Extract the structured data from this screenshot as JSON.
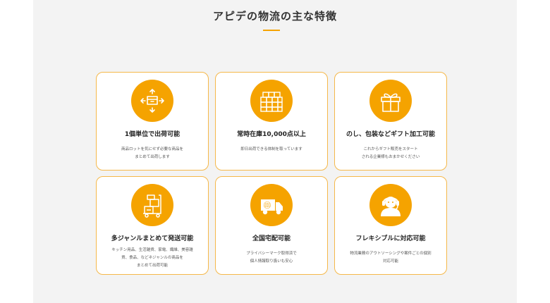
{
  "section": {
    "title": "アピデの物流の主な特徴"
  },
  "features": [
    {
      "title": "1個単位で出荷可能",
      "desc_line1": "商品ロットを気にせず必要な商品を",
      "desc_line2": "まとめて出荷します",
      "icon": "box-arrows-icon"
    },
    {
      "title": "常時在庫10,000点以上",
      "desc_line1": "即日出荷できる体制を取っています",
      "desc_line2": "",
      "icon": "stacked-boxes-icon"
    },
    {
      "title": "のし、包装などギフト加工可能",
      "desc_line1": "これからギフト販売をスタート",
      "desc_line2": "される企業様もおまかせください",
      "icon": "gift-icon"
    },
    {
      "title": "多ジャンルまとめて発送可能",
      "desc_line1": "キッチン用品、生活雑貨、家電、繊維、美容雑",
      "desc_line2": "貨、食品、などネジャンルの商品を",
      "desc_line3": "まとめて出荷可能",
      "icon": "hand-truck-icon"
    },
    {
      "title": "全国宅配可能",
      "desc_line1": "プライバシーマーク取得済で",
      "desc_line2": "個人情報取り扱いも安心",
      "icon": "delivery-truck-icon"
    },
    {
      "title": "フレキシブルに対応可能",
      "desc_line1": "物流業務のアウトソーシングや案件ごとの個別",
      "desc_line2": "対応可能",
      "icon": "support-operator-icon"
    }
  ],
  "colors": {
    "accent": "#f5a300",
    "card_border": "#f5b84a",
    "panel_bg": "#f3f3f3"
  }
}
